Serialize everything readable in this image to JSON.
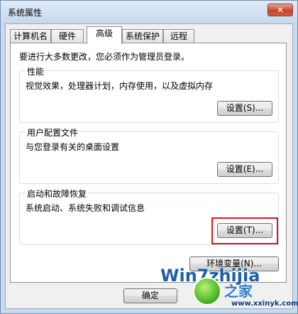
{
  "window": {
    "title": "系统属性",
    "close_label": "✕"
  },
  "tabs": [
    {
      "label": "计算机名"
    },
    {
      "label": "硬件"
    },
    {
      "label": "高级",
      "active": true
    },
    {
      "label": "系统保护"
    },
    {
      "label": "远程"
    }
  ],
  "advanced": {
    "note": "要进行大多数更改，您必须作为管理员登录。",
    "performance": {
      "label": "性能",
      "desc": "视觉效果，处理器计划，内存使用，以及虚拟内存",
      "button": "设置(S)..."
    },
    "user_profiles": {
      "label": "用户配置文件",
      "desc": "与您登录有关的桌面设置",
      "button": "设置(E)..."
    },
    "startup_recovery": {
      "label": "启动和故障恢复",
      "desc": "系统启动、系统失败和调试信息",
      "button": "设置(T)..."
    },
    "env_button": "环境变量(N)..."
  },
  "footer": {
    "ok": "确定"
  },
  "watermark": {
    "logo_text": "Win7zhijia",
    "brand": "之家",
    "site": "www.xxinyk.com"
  },
  "colors": {
    "highlight": "#e0141c",
    "accent": "#1f5ea8"
  }
}
